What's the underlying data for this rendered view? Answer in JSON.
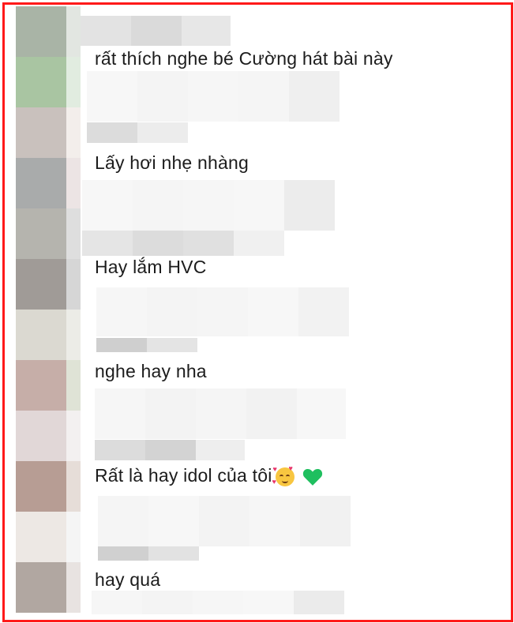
{
  "comments": [
    {
      "text": "rất thích nghe bé Cường hát bài này"
    },
    {
      "text": "Lấy hơi nhẹ nhàng"
    },
    {
      "text": "Hay lắm HVC"
    },
    {
      "text": "nghe hay nha"
    },
    {
      "text": "Rất là hay idol của tôi"
    },
    {
      "text": "hay quá"
    }
  ],
  "emojis": [
    "smiling-face-with-hearts-icon",
    "green-heart-icon"
  ],
  "colors": {
    "frame": "#ff1a1a",
    "text": "#1c1c1c",
    "green_heart": "#1fbf5f"
  }
}
